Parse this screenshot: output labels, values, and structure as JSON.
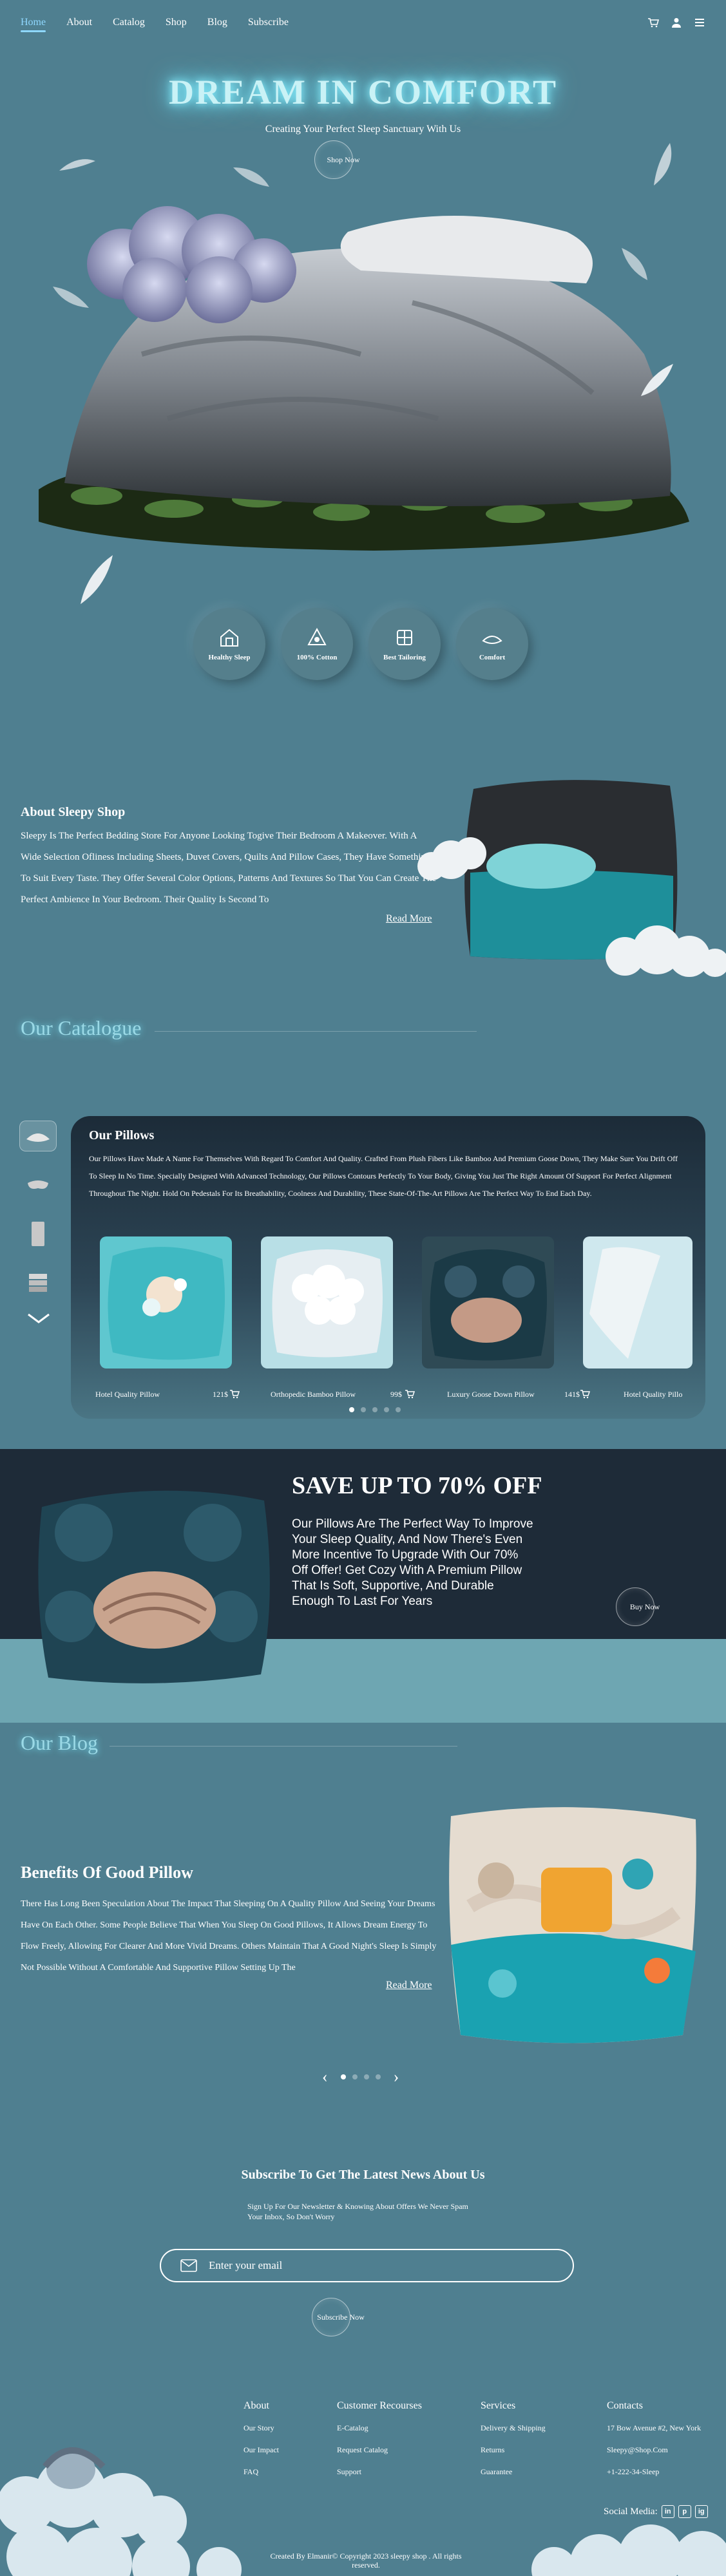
{
  "nav": {
    "links": [
      "Home",
      "About",
      "Catalog",
      "Shop",
      "Blog",
      "Subscribe"
    ],
    "active": "Home",
    "icons": [
      "cart-icon",
      "user-icon",
      "menu-icon"
    ]
  },
  "hero": {
    "title": "DREAM IN COMFORT",
    "subtitle": "Creating Your Perfect Sleep Sanctuary With Us",
    "button": "Shop Now",
    "features": [
      "Healthy Sleep",
      "100% Cotton",
      "Best Tailoring",
      "Comfort"
    ]
  },
  "about": {
    "title": "About Sleepy Shop",
    "text": "Sleepy Is The Perfect Bedding Store For Anyone Looking Togive Their Bedroom A Makeover. With A Wide Selection Ofliness Including Sheets, Duvet Covers, Quilts And Pillow Cases, They Have Something To Suit Every Taste. They Offer Several Color Options, Patterns And Textures So That You Can Create The Perfect Ambience In Your Bedroom. Their Quality Is Second To",
    "read_more": "Read More"
  },
  "catalogue": {
    "heading": "Our Catalogue",
    "panel_title": "Our Pillows",
    "panel_text": "Our Pillows Have Made A Name For Themselves With Regard To Comfort And Quality. Crafted From Plush Fibers Like Bamboo And Premium Goose Down, They Make Sure You Drift Off To Sleep In No Time. Specially Designed With Advanced Technology, Our Pillows Contours Perfectly To Your Body, Giving You Just The Right Amount Of Support For Perfect Alignment Throughout The Night. Hold On Pedestals For Its Breathability, Coolness And Durability, These State-Of-The-Art Pillows Are The Perfect Way To End Each Day.",
    "products": [
      {
        "name": "Hotel Quality Pillow",
        "price": "121$"
      },
      {
        "name": "Orthopedic Bamboo Pillow",
        "price": "99$"
      },
      {
        "name": "Luxury Goose Down Pillow",
        "price": "141$"
      },
      {
        "name": "Hotel Quality Pillo",
        "price": ""
      }
    ],
    "pager_active": 1,
    "pager_count": 5
  },
  "sale": {
    "title": "SAVE UP TO 70% OFF",
    "text": "Our Pillows Are The Perfect Way To Improve Your Sleep Quality, And Now There's Even More Incentive To Upgrade With Our 70% Off Offer! Get Cozy With A Premium Pillow That Is Soft, Supportive, And Durable Enough To Last For Years",
    "button": "Buy Now"
  },
  "blog": {
    "heading": "Our Blog",
    "title": "Benefits Of Good Pillow",
    "text": "There Has Long Been Speculation About The Impact That Sleeping On A Quality Pillow And Seeing Your Dreams Have On Each Other. Some People Believe That When You Sleep On Good Pillows, It Allows Dream Energy To Flow Freely, Allowing For Clearer And More Vivid Dreams. Others Maintain That A Good Night's Sleep Is Simply Not Possible Without A Comfortable And Supportive Pillow Setting Up The",
    "read_more": "Read More",
    "pager_active": 1,
    "pager_count": 4
  },
  "newsletter": {
    "title": "Subscribe To Get The Latest News About Us",
    "subtitle": "Sign Up For Our Newsletter & Knowing About Offers We Never Spam Your Inbox, So Don't Worry",
    "placeholder": "Enter your email",
    "button": "Subscribe Now"
  },
  "footer": {
    "columns": [
      {
        "title": "About",
        "items": [
          "Our Story",
          "Our Impact",
          "FAQ"
        ]
      },
      {
        "title": "Customer Recourses",
        "items": [
          "E-Catalog",
          "Request Catalog",
          "Support"
        ]
      },
      {
        "title": "Services",
        "items": [
          "Delivery & Shipping",
          "Returns",
          "Guarantee"
        ]
      },
      {
        "title": "Contacts",
        "items": [
          "17 Bow Avenue #2, New York",
          "Sleepy@Shop.Com",
          "+1-222-34-Sleep"
        ]
      }
    ],
    "social_label": "Social Media:",
    "social_icons": [
      "in",
      "p",
      "ig"
    ],
    "copyright": "Created By Elmanir© Copyright 2023 sleepy shop . All rights reserved."
  },
  "colors": {
    "background": "#4f7f90",
    "dark_band": "#1e2b38",
    "light_band": "#6ea6b2",
    "accent": "#8fd8ff",
    "glow": "#76e7ff"
  }
}
